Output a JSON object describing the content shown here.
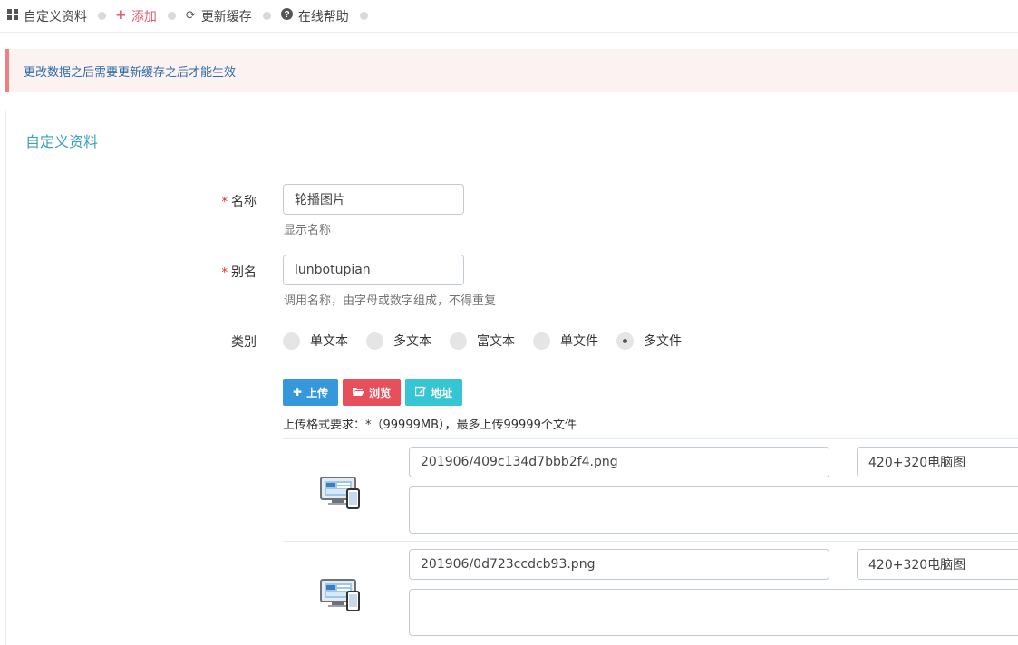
{
  "breadcrumb": [
    {
      "icon": "grid-icon",
      "label": "自定义资料"
    },
    {
      "icon": "plus-icon",
      "label": "添加"
    },
    {
      "icon": "refresh-icon",
      "label": "更新缓存"
    },
    {
      "icon": "question-icon",
      "label": "在线帮助"
    }
  ],
  "alert": {
    "text": "更改数据之后需要更新缓存之后才能生效"
  },
  "portlet": {
    "title": "自定义资料"
  },
  "form": {
    "name": {
      "label": "名称",
      "value": "轮播图片",
      "help": "显示名称"
    },
    "alias": {
      "label": "别名",
      "value": "lunbotupian",
      "help": "调用名称，由字母或数字组成，不得重复"
    },
    "type": {
      "label": "类别",
      "options": [
        "单文本",
        "多文本",
        "富文本",
        "单文件",
        "多文件"
      ],
      "selected": "多文件"
    },
    "buttons": {
      "upload": "上传",
      "browse": "浏览",
      "address": "地址"
    },
    "upload_hint": "上传格式要求：*（99999MB），最多上传99999个文件",
    "files": [
      {
        "path": "201906/409c134d7bbb2f4.png",
        "title": "420+320电脑图",
        "desc": ""
      },
      {
        "path": "201906/0d723ccdcb93.png",
        "title": "420+320电脑图",
        "desc": ""
      }
    ]
  }
}
